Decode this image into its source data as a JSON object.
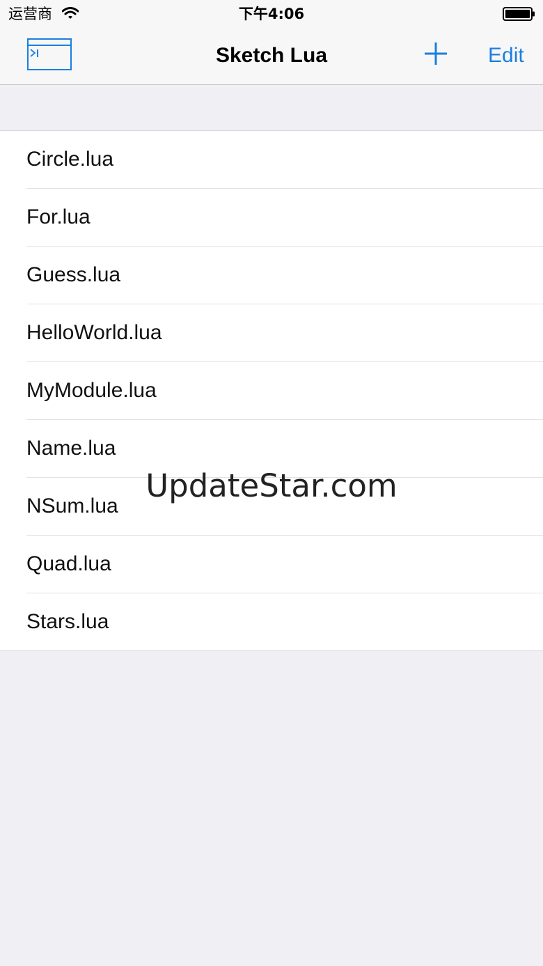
{
  "status_bar": {
    "carrier": "运营商",
    "time": "下午4:06",
    "wifi_icon": "wifi-icon",
    "battery_icon": "battery-icon"
  },
  "nav_bar": {
    "title": "Sketch Lua",
    "console_icon": "console-icon",
    "add_icon": "plus-icon",
    "edit_label": "Edit",
    "accent_color": "#1a7fdf"
  },
  "files": [
    {
      "name": "Circle.lua"
    },
    {
      "name": "For.lua"
    },
    {
      "name": "Guess.lua"
    },
    {
      "name": "HelloWorld.lua"
    },
    {
      "name": "MyModule.lua"
    },
    {
      "name": "Name.lua"
    },
    {
      "name": "NSum.lua"
    },
    {
      "name": "Quad.lua"
    },
    {
      "name": "Stars.lua"
    }
  ],
  "watermark": "UpdateStar.com"
}
